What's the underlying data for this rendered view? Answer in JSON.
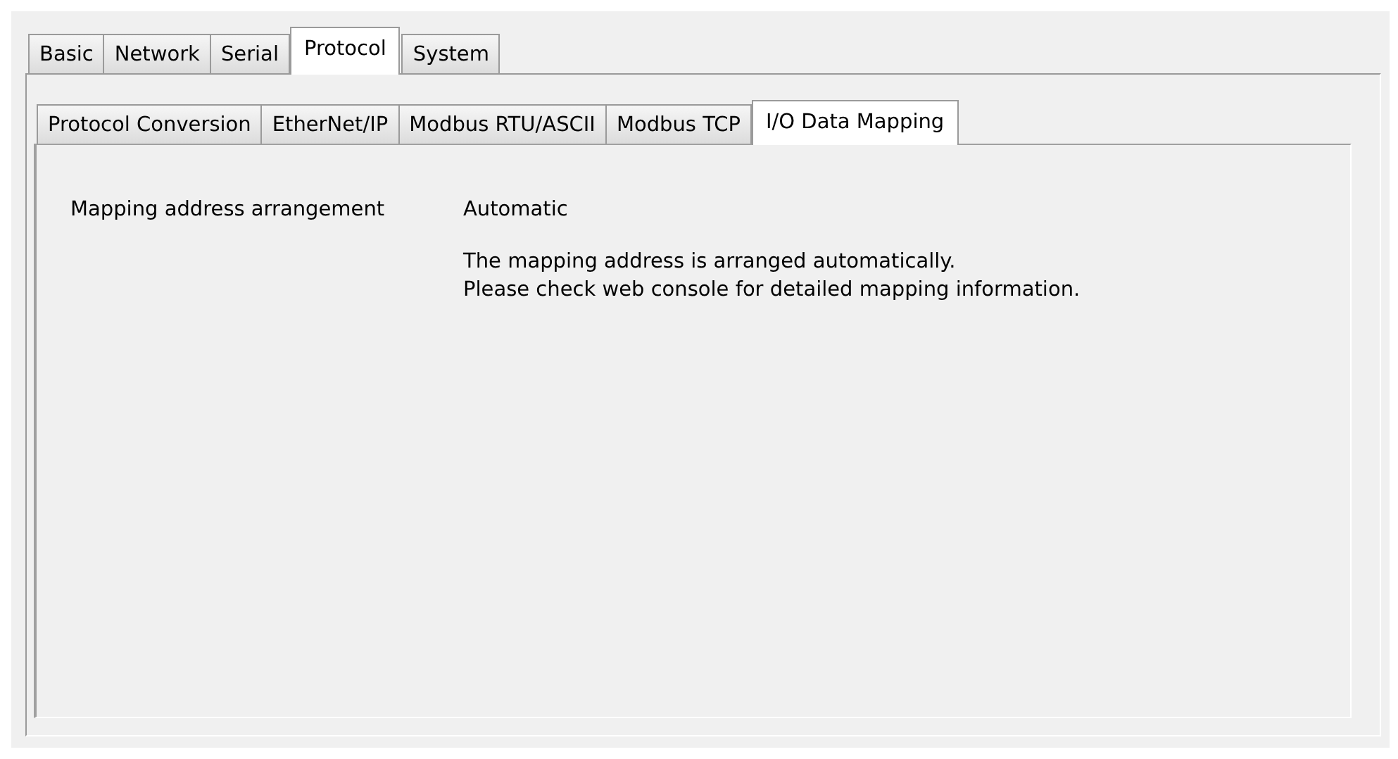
{
  "tabs": [
    {
      "label": "Basic",
      "selected": false
    },
    {
      "label": "Network",
      "selected": false
    },
    {
      "label": "Serial",
      "selected": false
    },
    {
      "label": "Protocol",
      "selected": true
    },
    {
      "label": "System",
      "selected": false
    }
  ],
  "subtabs": [
    {
      "label": "Protocol Conversion",
      "selected": false
    },
    {
      "label": "EtherNet/IP",
      "selected": false
    },
    {
      "label": "Modbus RTU/ASCII",
      "selected": false
    },
    {
      "label": "Modbus TCP",
      "selected": false
    },
    {
      "label": "I/O Data Mapping",
      "selected": true
    }
  ],
  "setting": {
    "label": "Mapping address arrangement",
    "value": "Automatic",
    "description": [
      "The mapping address is arranged automatically.",
      "Please check web console for detailed mapping information."
    ]
  }
}
